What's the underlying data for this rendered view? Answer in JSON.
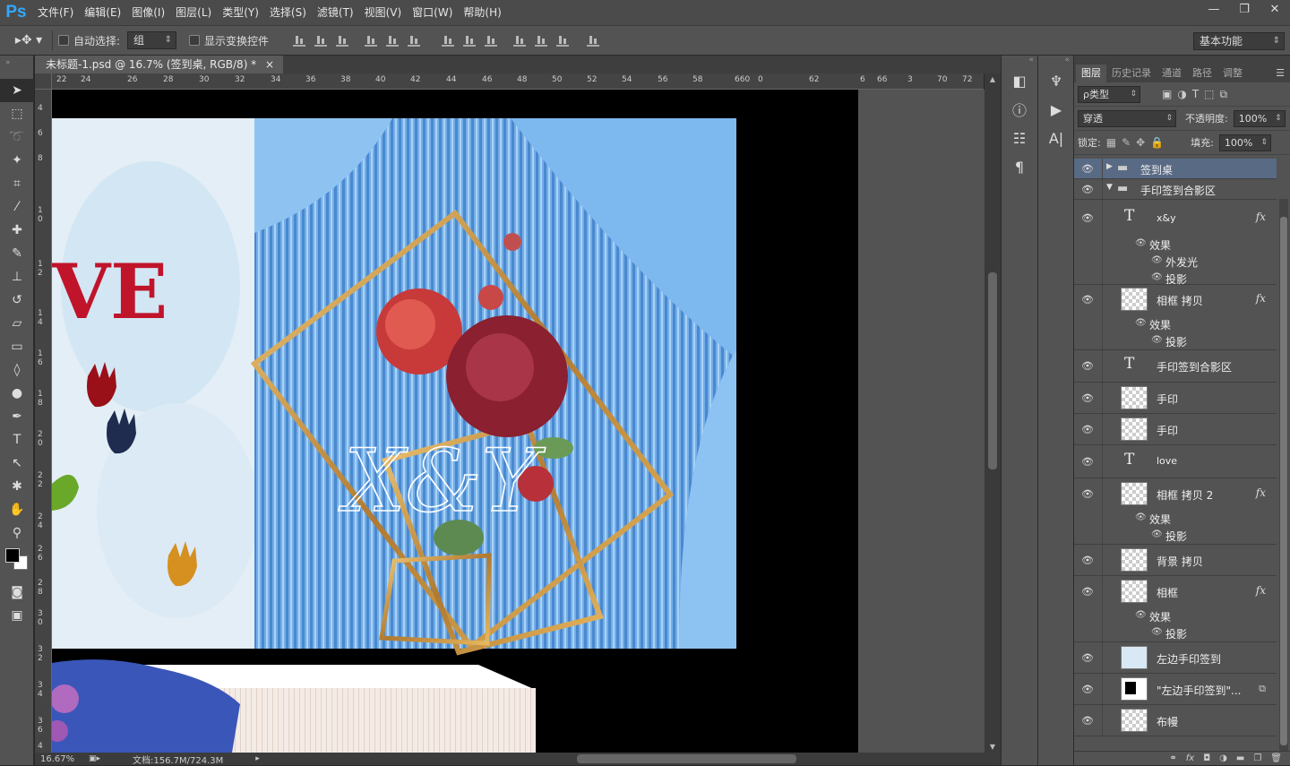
{
  "app": {
    "logo": "Ps"
  },
  "menu": [
    "文件(F)",
    "编辑(E)",
    "图像(I)",
    "图层(L)",
    "类型(Y)",
    "选择(S)",
    "滤镜(T)",
    "视图(V)",
    "窗口(W)",
    "帮助(H)"
  ],
  "window_controls": {
    "minimize": "—",
    "restore": "❐",
    "close": "✕"
  },
  "options": {
    "auto_select_label": "自动选择:",
    "auto_select_value": "组",
    "show_transform_label": "显示变换控件",
    "workspace": "基本功能"
  },
  "document": {
    "tab_title": "未标题-1.psd @ 16.7% (签到桌, RGB/8) *",
    "tab_close": "×",
    "zoom": "16.67%",
    "doc_size": "文档:156.7M/724.3M"
  },
  "ruler_h": [
    "22",
    "24",
    "26",
    "28",
    "30",
    "32",
    "34",
    "36",
    "38",
    "40",
    "42",
    "44",
    "46",
    "48",
    "50",
    "52",
    "54",
    "56",
    "58",
    "660",
    "0",
    "62",
    "6",
    "66",
    "3",
    "70",
    "72"
  ],
  "ruler_v": [
    "4",
    "6",
    "8",
    "10",
    "12",
    "14",
    "16",
    "18",
    "20",
    "22",
    "24",
    "26",
    "28",
    "30",
    "32",
    "34",
    "36",
    "4"
  ],
  "canvas": {
    "love_text": "VE",
    "monogram": "X&Y"
  },
  "layers_panel": {
    "tabs": [
      "图层",
      "历史记录",
      "通道",
      "路径",
      "调整"
    ],
    "filter_kind": "ρ类型",
    "blend_mode": "穿透",
    "opacity_label": "不透明度:",
    "opacity_value": "100%",
    "lock_label": "锁定:",
    "fill_label": "填充:",
    "fill_value": "100%",
    "layers": [
      {
        "name": "签到桌",
        "kind": "group-closed"
      },
      {
        "name": "手印签到合影区",
        "kind": "group-open"
      },
      {
        "name": "x&y",
        "kind": "text",
        "fx": "fx",
        "effects_label": "效果",
        "effects": [
          "外发光",
          "投影"
        ]
      },
      {
        "name": "相框 拷贝",
        "kind": "pixel",
        "fx": "fx",
        "effects_label": "效果",
        "effects": [
          "投影"
        ]
      },
      {
        "name": "手印签到合影区",
        "kind": "text"
      },
      {
        "name": "手印",
        "kind": "pixel"
      },
      {
        "name": "手印",
        "kind": "pixel"
      },
      {
        "name": "love",
        "kind": "text"
      },
      {
        "name": "相框 拷贝 2",
        "kind": "pixel",
        "fx": "fx",
        "effects_label": "效果",
        "effects": [
          "投影"
        ]
      },
      {
        "name": "背景 拷贝",
        "kind": "pixel"
      },
      {
        "name": "相框",
        "kind": "pixel",
        "fx": "fx",
        "effects_label": "效果",
        "effects": [
          "投影"
        ]
      },
      {
        "name": "左边手印签到",
        "kind": "pixel"
      },
      {
        "name": "\"左边手印签到\"...",
        "kind": "pixel-mask"
      },
      {
        "name": "布幔",
        "kind": "pixel"
      }
    ]
  }
}
